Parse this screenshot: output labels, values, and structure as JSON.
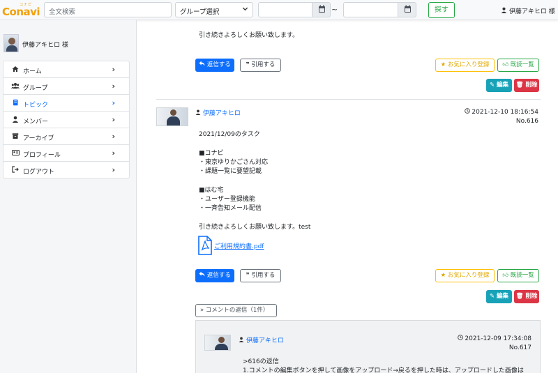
{
  "header": {
    "logo_ruby": "コナビ",
    "logo_text": "Conavi",
    "search_placeholder": "全文検索",
    "group_select": "グループ選択",
    "date_separator": "~",
    "find_button": "探す",
    "user_name": "伊藤アキヒロ 様"
  },
  "sidebar": {
    "user_name": "伊藤アキヒロ 様",
    "items": [
      {
        "label": "ホーム",
        "icon": "home-icon",
        "active": false
      },
      {
        "label": "グループ",
        "icon": "users-icon",
        "active": false
      },
      {
        "label": "トピック",
        "icon": "book-icon",
        "active": true
      },
      {
        "label": "メンバー",
        "icon": "user-icon",
        "active": false
      },
      {
        "label": "アーカイブ",
        "icon": "archive-icon",
        "active": false
      },
      {
        "label": "プロフィール",
        "icon": "id-card-icon",
        "active": false
      },
      {
        "label": "ログアウト",
        "icon": "logout-icon",
        "active": false
      }
    ]
  },
  "post_prev": {
    "closing_text": "引き続きよろしくお願い致します。",
    "reply_label": "返信する",
    "quote_label": "引用する",
    "favorite_label": "お気に入り登録",
    "read_list_label": "既読一覧",
    "edit_label": "編集",
    "delete_label": "削除"
  },
  "post": {
    "author": "伊藤アキヒロ",
    "datetime": "2021-12-10 18:16:54",
    "number": "No.616",
    "lines": [
      "2021/12/09のタスク",
      "",
      "■コナビ",
      "・東京ゆりかごさん対応",
      "・課題一覧に要望記載",
      "",
      "■はむ宅",
      "・ユーザー登録機能",
      "・一斉告知メール配信",
      "",
      "引き続きよろしくお願い致します。test"
    ],
    "attachment": "ご利用規約書.pdf",
    "reply_label": "返信する",
    "quote_label": "引用する",
    "favorite_label": "お気に入り登録",
    "read_list_label": "既読一覧",
    "edit_label": "編集",
    "delete_label": "削除",
    "comments_toggle": "コメントの返信（1件）"
  },
  "comment": {
    "author": "伊藤アキヒロ",
    "datetime": "2021-12-09 17:34:08",
    "number": "No.617",
    "line1": ">616の返信",
    "line2": "1.コメントの編集ボタンを押して画像をアップロード→戻るを押した時は、アップロードした画像は"
  },
  "colors": {
    "primary": "#0d6efd",
    "info": "#17a2b8",
    "danger": "#dc3545",
    "warning": "#ffc107",
    "success": "#28a745",
    "logo": "#f2a10e"
  }
}
